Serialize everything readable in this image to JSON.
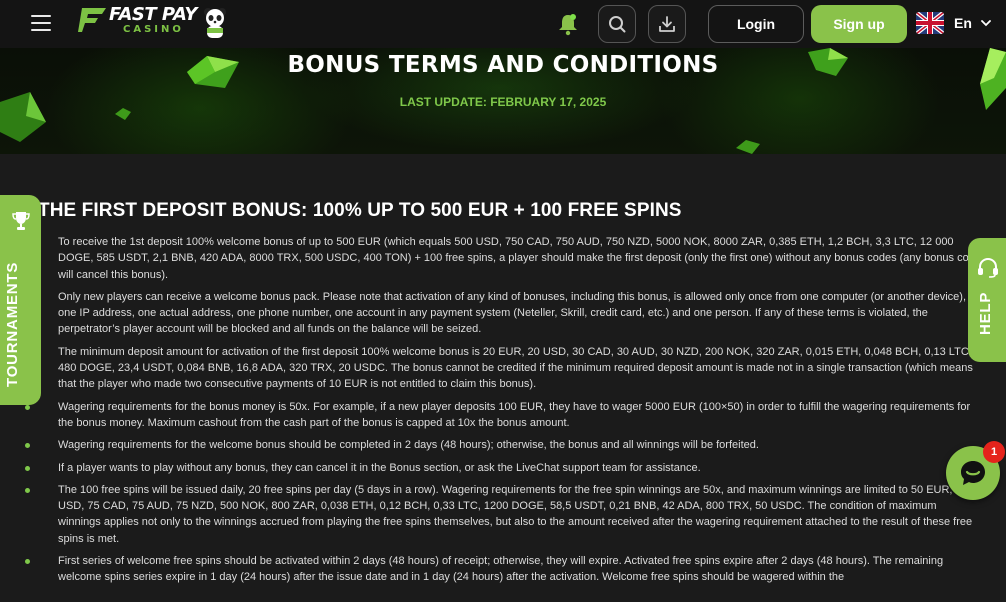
{
  "header": {
    "logo_top": "FAST PAY",
    "logo_bottom": "CASINO",
    "login_label": "Login",
    "signup_label": "Sign up",
    "language": "En",
    "accent_color": "#8ac24a"
  },
  "banner": {
    "title": "BONUS TERMS AND CONDITIONS",
    "last_update": "LAST UPDATE: FEBRUARY 17, 2025"
  },
  "side": {
    "tournaments_label": "TOURNAMENTS",
    "help_label": "HELP"
  },
  "chat": {
    "badge_count": "1"
  },
  "section": {
    "title": "THE FIRST DEPOSIT BONUS: 100% UP TO 500 EUR + 100 FREE SPINS",
    "items": [
      "To receive the 1st deposit 100% welcome bonus of up to 500 EUR (which equals 500 USD, 750 CAD, 750 AUD, 750 NZD, 5000 NOK, 8000 ZAR, 0,385 ETH, 1,2 BCH, 3,3 LTC, 12 000 DOGE, 585 USDT, 2,1 BNB, 420 ADA, 8000 TRX, 500 USDC, 400 TON) + 100 free spins, a player should make the first deposit (only the first one) without any bonus codes (any bonus code will cancel this bonus).",
      "Only new players can receive a welcome bonus pack. Please note that activation of any kind of bonuses, including this bonus, is allowed only once from one computer (or another device), one IP address, one actual address, one phone number, one account in any payment system (Neteller, Skrill, credit card, etc.) and one person. If any of these terms is violated, the perpetrator’s player account will be blocked and all funds on the balance will be seized.",
      "The minimum deposit amount for activation of the first deposit 100% welcome bonus is 20 EUR, 20 USD, 30 CAD, 30 AUD, 30 NZD, 200 NOK, 320 ZAR, 0,015 ETH, 0,048 BCH, 0,13 LTC, 480 DOGE, 23,4 USDT, 0,084 BNB, 16,8 ADA, 320 TRX, 20 USDC. The bonus cannot be credited if the minimum required deposit amount is made not in a single transaction (which means that the player who made two consecutive payments of 10 EUR is not entitled to claim this bonus).",
      "Wagering requirements for the bonus money is 50x. For example, if a new player deposits 100 EUR, they have to wager 5000 EUR (100×50) in order to fulfill the wagering requirements for the bonus money. Maximum cashout from the cash part of the bonus is capped at 10x the bonus amount.",
      "Wagering requirements for the welcome bonus should be completed in 2 days (48 hours); otherwise, the bonus and all winnings will be forfeited.",
      "If a player wants to play without any bonus, they can cancel it in the Bonus section, or ask the LiveChat support team for assistance.",
      "The 100 free spins will be issued daily, 20 free spins per day (5 days in a row). Wagering requirements for the free spin winnings are 50x, and maximum winnings are limited to 50 EUR, 50 USD, 75 CAD, 75 AUD, 75 NZD, 500 NOK, 800 ZAR, 0,038 ETH, 0,12 BCH, 0,33 LTC, 1200 DOGE, 58,5 USDT, 0,21 BNB, 42 ADA, 800 TRX, 50 USDC. The condition of maximum winnings applies not only to the winnings accrued from playing the free spins themselves, but also to the amount received after the wagering requirement attached to the result of these free spins is met.",
      "First series of welcome free spins should be activated within 2 days (48 hours) of receipt; otherwise, they will expire. Activated free spins expire after 2 days (48 hours). The remaining welcome spins series expire in 1 day (24 hours) after the issue date and in 1 day (24 hours) after the activation. Welcome free spins should be wagered within the"
    ]
  }
}
